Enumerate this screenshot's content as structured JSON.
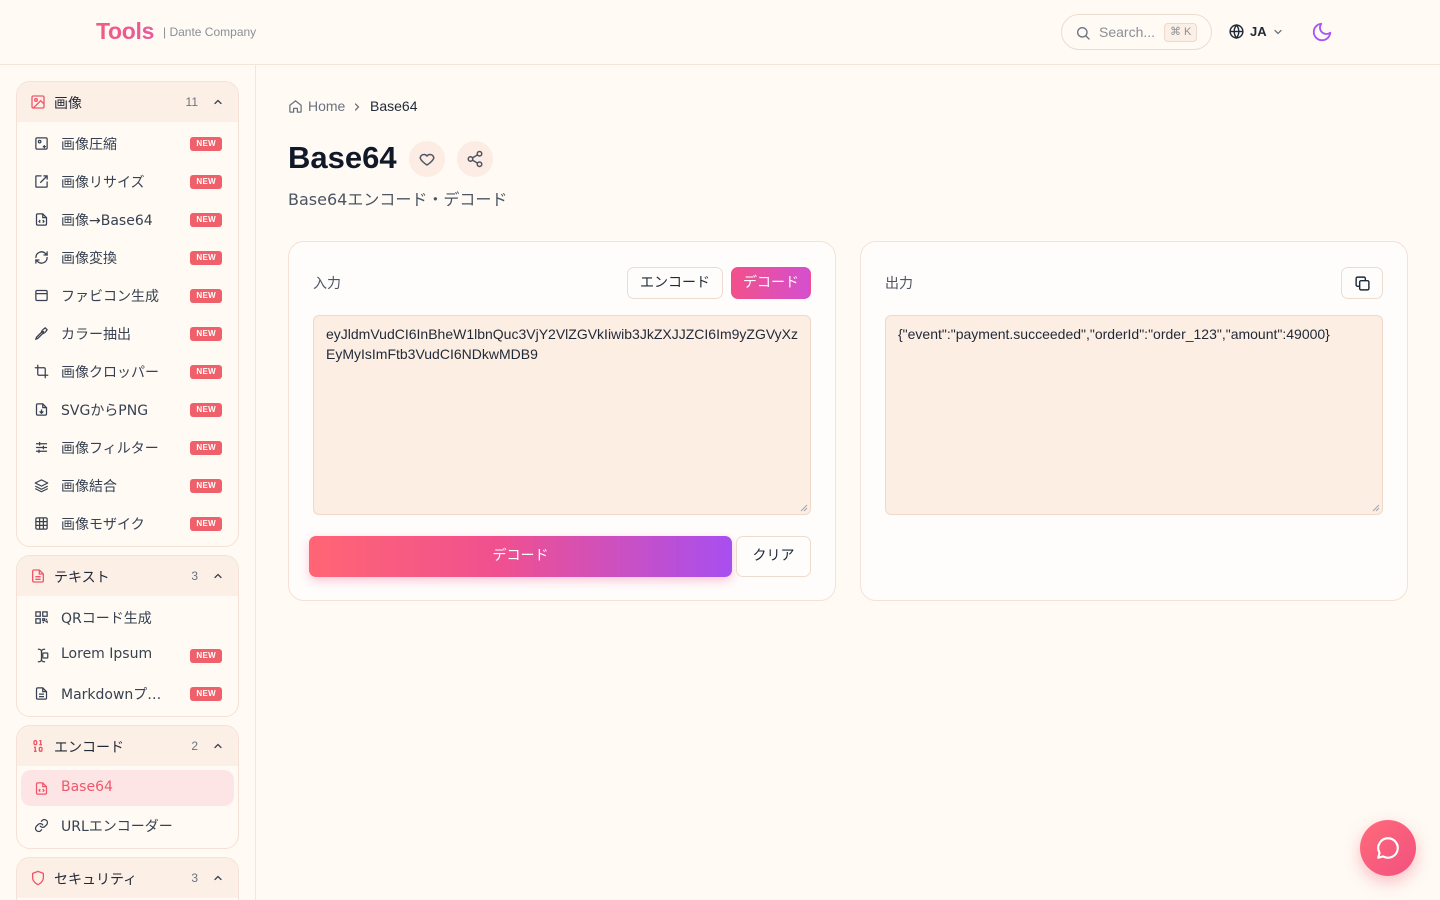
{
  "header": {
    "logo": "Tools",
    "company": "| Dante Company",
    "search_placeholder": "Search...",
    "search_shortcut": "⌘ K",
    "language": "JA"
  },
  "sidebar": {
    "groups": [
      {
        "title": "画像",
        "count": "11",
        "items": [
          {
            "label": "画像圧縮",
            "badge": "NEW",
            "icon": "image-compress-icon"
          },
          {
            "label": "画像リサイズ",
            "badge": "NEW",
            "icon": "resize-icon"
          },
          {
            "label": "画像→Base64",
            "badge": "NEW",
            "icon": "file-code-icon"
          },
          {
            "label": "画像変換",
            "badge": "NEW",
            "icon": "refresh-icon"
          },
          {
            "label": "ファビコン生成",
            "badge": "NEW",
            "icon": "browser-window-icon"
          },
          {
            "label": "カラー抽出",
            "badge": "NEW",
            "icon": "eyedropper-icon"
          },
          {
            "label": "画像クロッパー",
            "badge": "NEW",
            "icon": "crop-icon"
          },
          {
            "label": "SVGからPNG",
            "badge": "NEW",
            "icon": "file-image-icon"
          },
          {
            "label": "画像フィルター",
            "badge": "NEW",
            "icon": "sliders-icon"
          },
          {
            "label": "画像結合",
            "badge": "NEW",
            "icon": "layers-icon"
          },
          {
            "label": "画像モザイク",
            "badge": "NEW",
            "icon": "grid-icon"
          }
        ]
      },
      {
        "title": "テキスト",
        "count": "3",
        "items": [
          {
            "label": "QRコード生成",
            "badge": "",
            "icon": "qr-code-icon"
          },
          {
            "label": "Lorem Ipsum",
            "badge": "NEW",
            "icon": "text-cursor-icon"
          },
          {
            "label": "Markdownプレビュー",
            "badge": "NEW",
            "icon": "file-text-icon"
          }
        ]
      },
      {
        "title": "エンコード",
        "count": "2",
        "items": [
          {
            "label": "Base64",
            "badge": "",
            "icon": "file-code-icon"
          },
          {
            "label": "URLエンコーダー",
            "badge": "",
            "icon": "link-icon"
          }
        ]
      },
      {
        "title": "セキュリティ",
        "count": "3",
        "items": []
      }
    ]
  },
  "breadcrumb": {
    "home": "Home",
    "current": "Base64"
  },
  "page": {
    "title": "Base64",
    "subtitle": "Base64エンコード・デコード"
  },
  "input_card": {
    "label": "入力",
    "encode_label": "エンコード",
    "decode_label": "デコード",
    "value": "eyJldmVudCI6InBheW1lbnQuc3VjY2VlZGVkIiwib3JkZXJJZCI6Im9yZGVyXzEyMyIsImFtb3VudCI6NDkwMDB9",
    "run_label": "デコード",
    "clear_label": "クリア"
  },
  "output_card": {
    "label": "出力",
    "value": "{\"event\":\"payment.succeeded\",\"orderId\":\"order_123\",\"amount\":49000}"
  },
  "colors": {
    "accent": "#f0576b",
    "gradient_start": "#ff6574",
    "gradient_end": "#a84ff0",
    "badge": "#f0606a"
  }
}
